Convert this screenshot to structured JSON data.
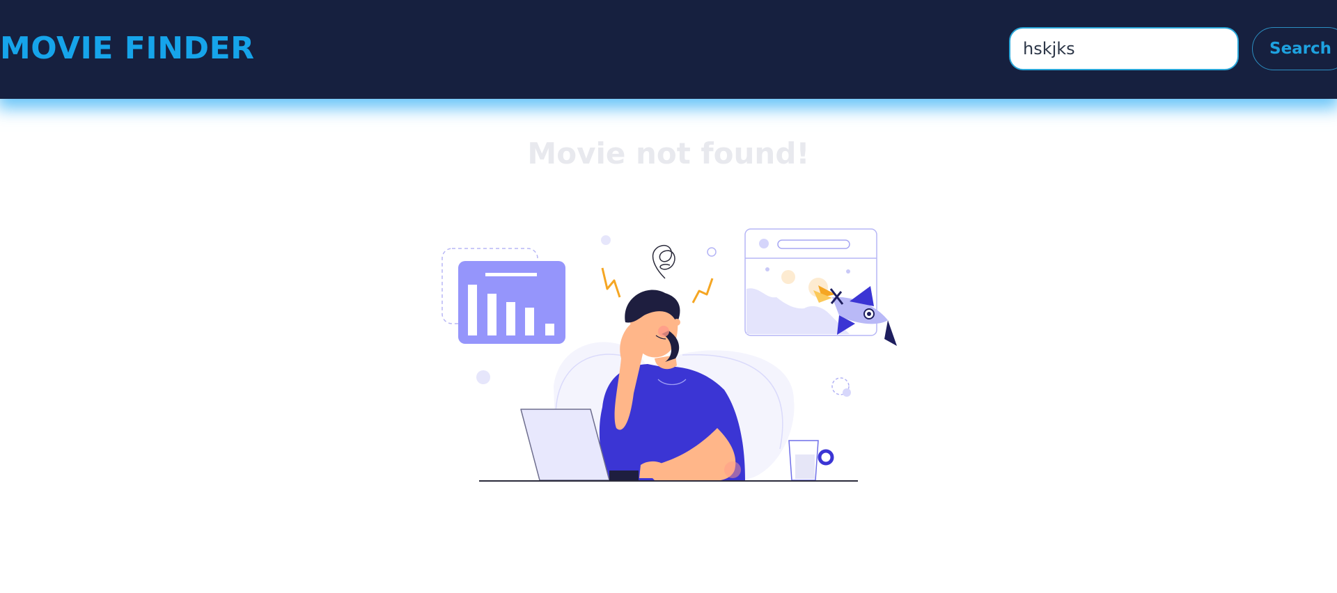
{
  "header": {
    "brand": "MOVIE FINDER",
    "search": {
      "value": "hskjks",
      "placeholder": ""
    },
    "search_button_label": "Search"
  },
  "main": {
    "message": "Movie not found!",
    "illustration": "frustrated-person-at-laptop"
  },
  "colors": {
    "navbar_bg": "#16203f",
    "brand": "#16a4ea",
    "glow": "#38b2f5",
    "message": "#e8e9ee",
    "illustration_accent": "#3b35d4",
    "illustration_light": "#9595fb"
  }
}
